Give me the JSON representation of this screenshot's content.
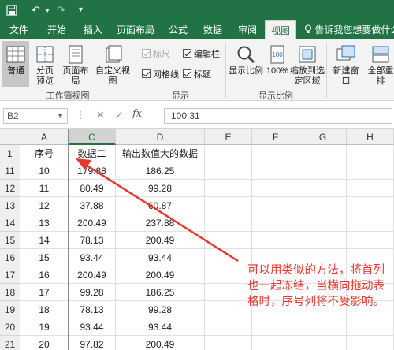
{
  "quick_access": {
    "undo_label": "↶",
    "redo_label": "↷",
    "customize_label": "▾"
  },
  "tabs": [
    {
      "label": "文件",
      "active": false
    },
    {
      "label": "开始",
      "active": false
    },
    {
      "label": "插入",
      "active": false
    },
    {
      "label": "页面布局",
      "active": false
    },
    {
      "label": "公式",
      "active": false
    },
    {
      "label": "数据",
      "active": false
    },
    {
      "label": "审阅",
      "active": false
    },
    {
      "label": "视图",
      "active": true
    }
  ],
  "tell_me": "告诉我您想要做什么...",
  "ribbon": {
    "workbook_views": {
      "group_label": "工作簿视图",
      "normal": "普通",
      "page_break": "分页预览",
      "page_layout": "页面布局",
      "custom_views": "自定义视图"
    },
    "show": {
      "group_label": "显示",
      "ruler": {
        "label": "标尺",
        "checked": true,
        "disabled": true
      },
      "formula_bar": {
        "label": "编辑栏",
        "checked": true
      },
      "gridlines": {
        "label": "网格线",
        "checked": true
      },
      "headings": {
        "label": "标题",
        "checked": true
      }
    },
    "zoom": {
      "group_label": "显示比例",
      "zoom": "显示比例",
      "hundred": "100%",
      "zoom_to_selection": "缩放到选定区域"
    },
    "window": {
      "new_window": "新建窗口",
      "arrange_all": "全部重排"
    }
  },
  "formula_bar": {
    "name_box": "B2",
    "cancel_symbol": "✕",
    "enter_symbol": "✓",
    "fx_label": "fx",
    "value": "100.31"
  },
  "sheet": {
    "columns": [
      "A",
      "C",
      "D",
      "E",
      "F",
      "G",
      "H"
    ],
    "header_row": {
      "row": "1",
      "cells": [
        "序号",
        "数据二",
        "输出数值大的数据"
      ]
    },
    "rows": [
      {
        "row": "11",
        "cells": [
          "10",
          "179.88",
          "186.25"
        ]
      },
      {
        "row": "12",
        "cells": [
          "11",
          "80.49",
          "99.28"
        ]
      },
      {
        "row": "13",
        "cells": [
          "12",
          "37.88",
          "60.87"
        ]
      },
      {
        "row": "14",
        "cells": [
          "13",
          "200.49",
          "237.88"
        ]
      },
      {
        "row": "15",
        "cells": [
          "14",
          "78.13",
          "200.49"
        ]
      },
      {
        "row": "16",
        "cells": [
          "15",
          "93.44",
          "93.44"
        ]
      },
      {
        "row": "17",
        "cells": [
          "16",
          "200.49",
          "200.49"
        ]
      },
      {
        "row": "18",
        "cells": [
          "17",
          "99.28",
          "186.25"
        ]
      },
      {
        "row": "19",
        "cells": [
          "18",
          "78.13",
          "99.28"
        ]
      },
      {
        "row": "20",
        "cells": [
          "19",
          "93.44",
          "93.44"
        ]
      },
      {
        "row": "21",
        "cells": [
          "20",
          "97.82",
          "200.49"
        ]
      }
    ]
  },
  "annotation": "可以用类似的方法，将首列也一起冻结，当横向拖动表格时，序号列将不受影响。",
  "colors": {
    "excel_green": "#217346",
    "annotation_red": "#e8372c"
  }
}
